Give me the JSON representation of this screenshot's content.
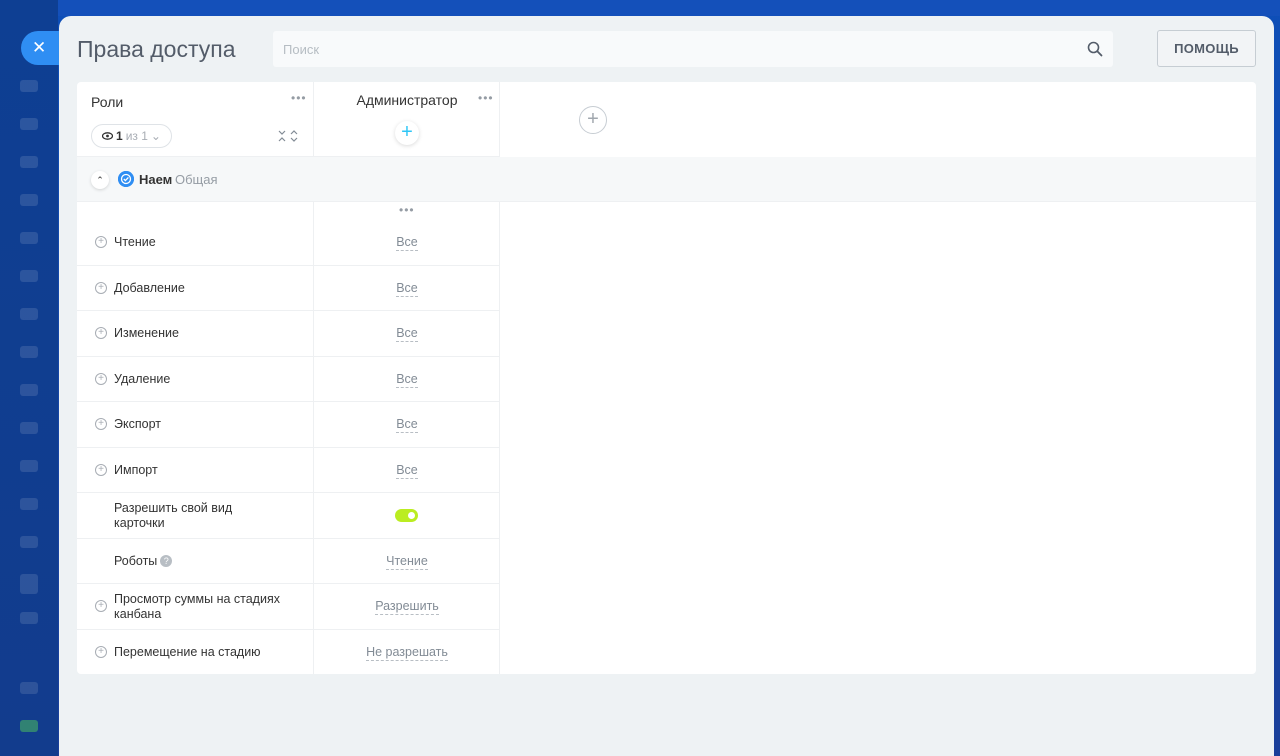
{
  "window": {
    "title": "Права доступа"
  },
  "search": {
    "placeholder": "Поиск"
  },
  "help_button": "ПОМОЩЬ",
  "roles_column": {
    "label": "Роли",
    "counter": {
      "current": "1",
      "of_label": "из 1"
    }
  },
  "admin_column": {
    "title": "Администратор"
  },
  "section": {
    "name": "Наем",
    "type": "Общая"
  },
  "permissions": [
    {
      "label": "Чтение",
      "value": "Все",
      "expandable": true
    },
    {
      "label": "Добавление",
      "value": "Все",
      "expandable": true
    },
    {
      "label": "Изменение",
      "value": "Все",
      "expandable": true
    },
    {
      "label": "Удаление",
      "value": "Все",
      "expandable": true
    },
    {
      "label": "Экспорт",
      "value": "Все",
      "expandable": true
    },
    {
      "label": "Импорт",
      "value": "Все",
      "expandable": true
    },
    {
      "label_line1": "Разрешить свой вид",
      "label_line2": "карточки",
      "value_type": "toggle",
      "value": "on",
      "expandable": false
    },
    {
      "label": "Роботы",
      "value": "Чтение",
      "expandable": false,
      "help": true
    },
    {
      "label_line1": "Просмотр суммы на стадиях",
      "label_line2": "канбана",
      "value": "Разрешить",
      "expandable": true
    },
    {
      "label": "Перемещение на стадию",
      "value": "Не разрешать",
      "expandable": true
    }
  ],
  "colors": {
    "accent": "#2f8ef3",
    "toggle_on": "#bbed21",
    "add_icon": "#2fc6f6"
  }
}
